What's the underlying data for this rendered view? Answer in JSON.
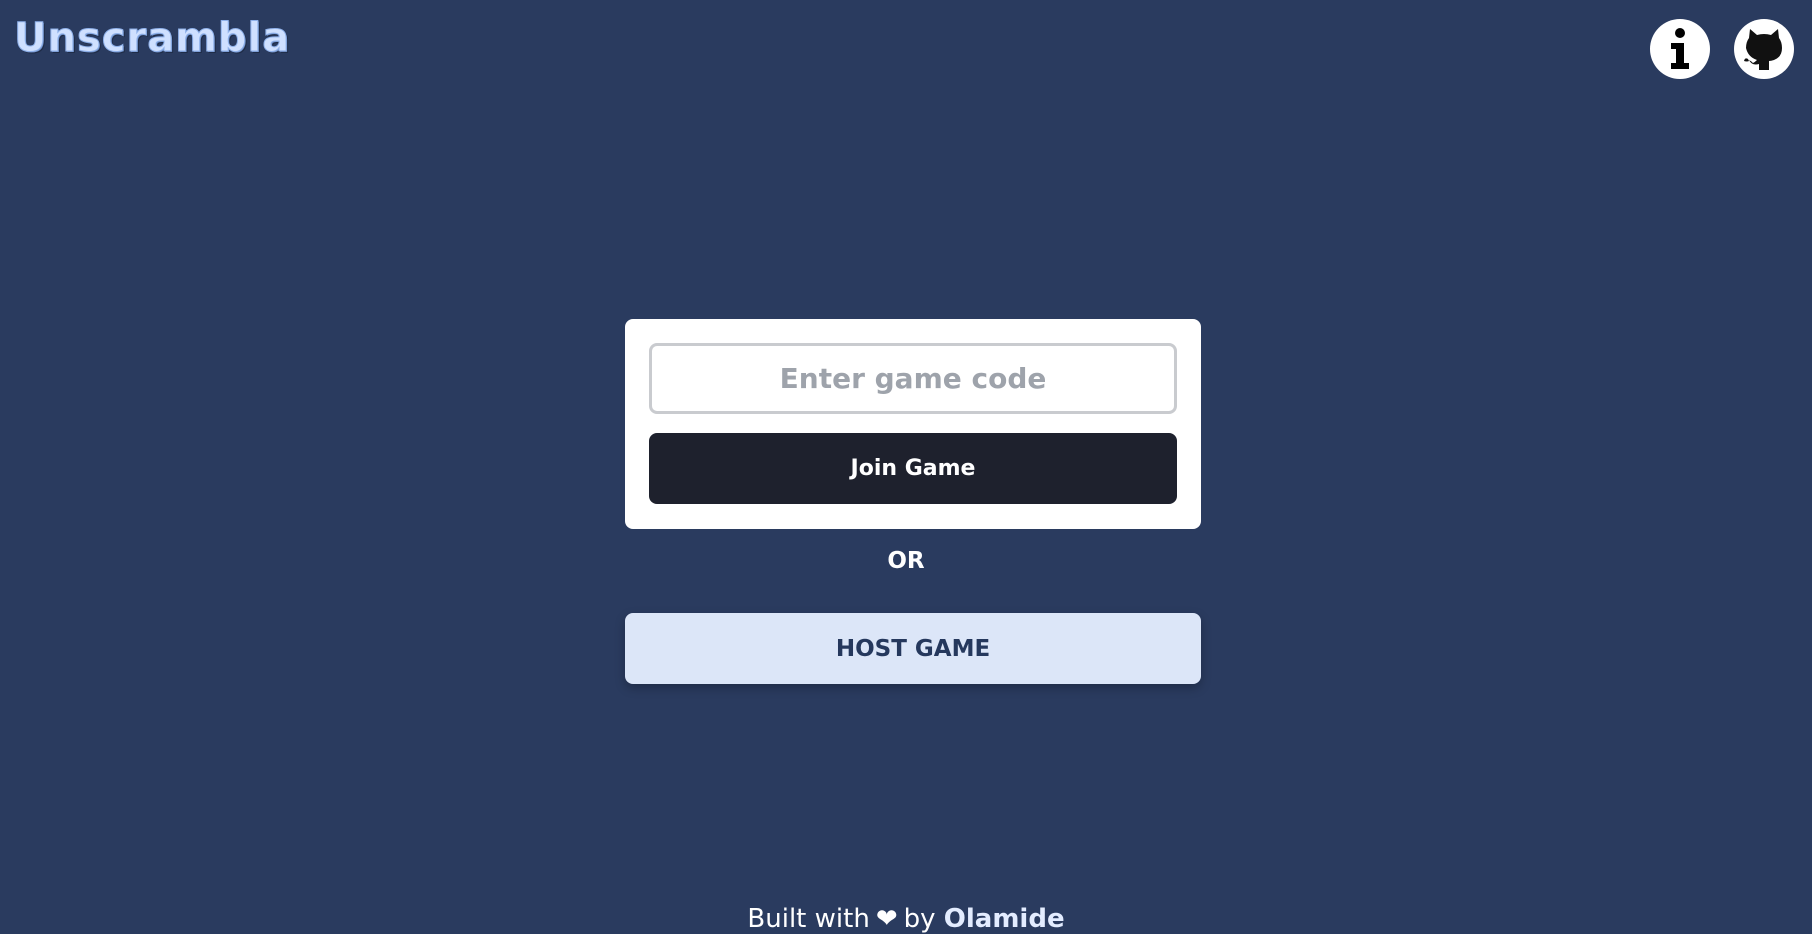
{
  "header": {
    "logo_text": "Unscrambla",
    "icons": [
      {
        "name": "info-icon",
        "glyph": "i"
      },
      {
        "name": "github-icon"
      }
    ]
  },
  "join_card": {
    "code_input": {
      "value": "",
      "placeholder": "Enter game code"
    },
    "join_label": "Join Game"
  },
  "separator_text": "OR",
  "host_label": "HOST GAME",
  "footer": {
    "prefix": "Built with",
    "heart": "❤",
    "by": "by",
    "author": "Olamide"
  },
  "colors": {
    "background": "#2a3b5f",
    "card": "#ffffff",
    "join_button": "#1e212d",
    "host_button": "#dce6f8",
    "host_text": "#25385d",
    "logo": "#cfe0ff"
  }
}
